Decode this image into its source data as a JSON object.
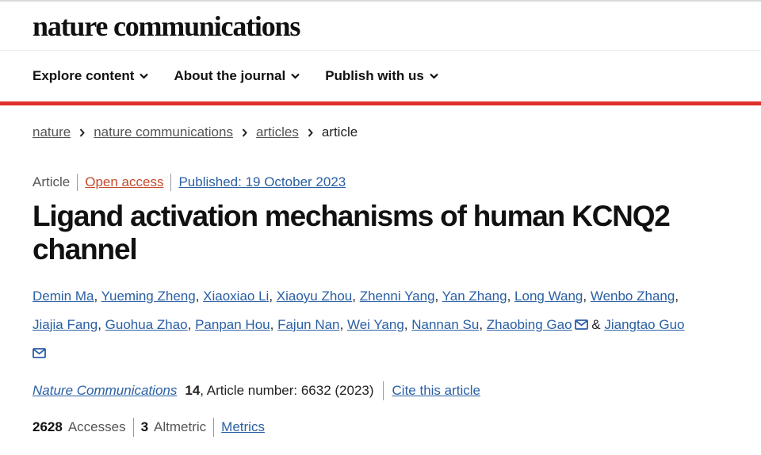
{
  "brand": {
    "logo_text": "nature communications"
  },
  "nav": {
    "items": [
      {
        "label": "Explore content"
      },
      {
        "label": "About the journal"
      },
      {
        "label": "Publish with us"
      }
    ]
  },
  "breadcrumb": {
    "items": [
      "nature",
      "nature communications",
      "articles"
    ],
    "current": "article"
  },
  "article": {
    "type": "Article",
    "access": "Open access",
    "published": "Published: 19 October 2023",
    "title": "Ligand activation mechanisms of human KCNQ2 channel",
    "authors": [
      "Demin Ma",
      "Yueming Zheng",
      "Xiaoxiao Li",
      "Xiaoyu Zhou",
      "Zhenni Yang",
      "Yan Zhang",
      "Long Wang",
      "Wenbo Zhang",
      "Jiajia Fang",
      "Guohua Zhao",
      "Panpan Hou",
      "Fajun Nan",
      "Wei Yang",
      "Nannan Su",
      "Zhaobing Gao",
      "Jiangtao Guo"
    ],
    "authors_joiner": "&",
    "journal": "Nature Communications",
    "volume": "14",
    "article_number": ", Article number: 6632 (2023)",
    "cite_label": "Cite this article",
    "accesses_count": "2628",
    "accesses_label": "Accesses",
    "altmetric_count": "3",
    "altmetric_label": "Altmetric",
    "metrics_label": "Metrics"
  },
  "colors": {
    "accent_bar": "#e0302b",
    "link": "#2a5fa4",
    "open_access": "#c54a2c"
  },
  "icons": {
    "chevron": "chevron-down-icon",
    "crumb_separator": "chevron-right-icon",
    "mail": "mail-icon"
  }
}
